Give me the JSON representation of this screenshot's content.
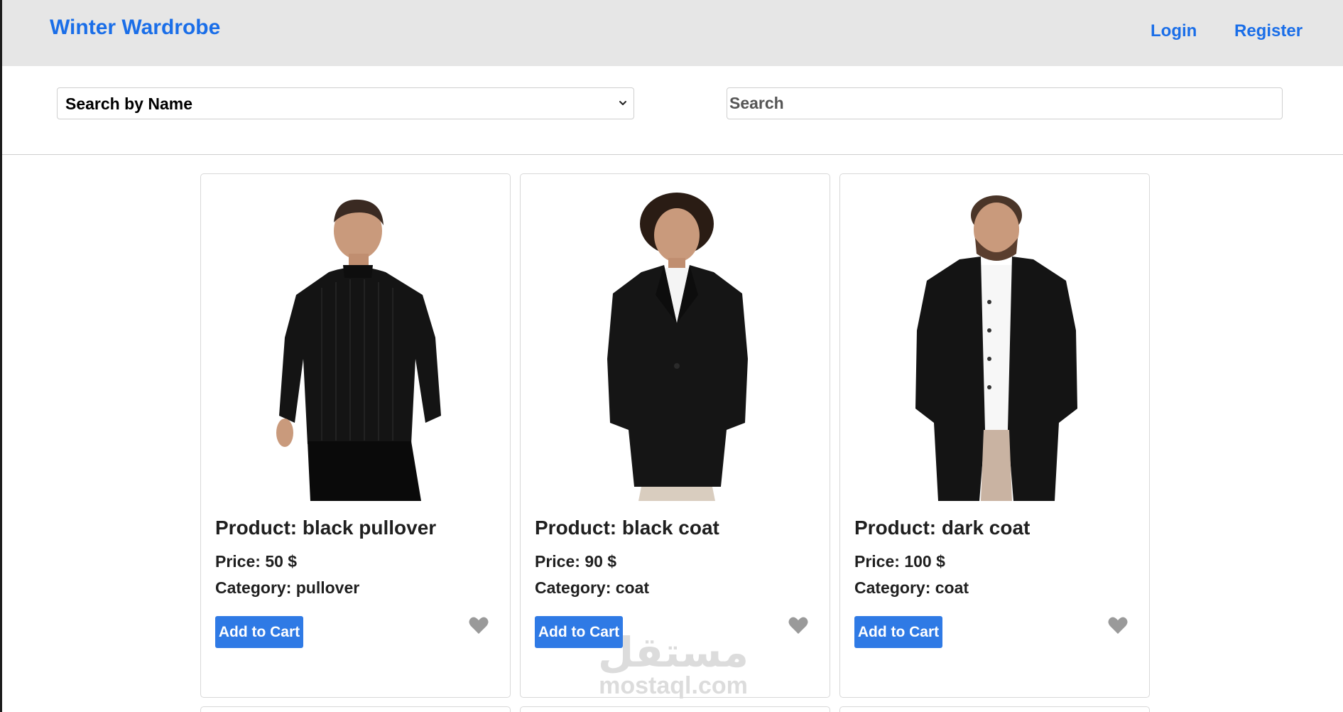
{
  "navbar": {
    "brand": "Winter Wardrobe",
    "login_label": "Login",
    "register_label": "Register"
  },
  "search": {
    "select_value": "Search by Name",
    "input_placeholder": "Search",
    "input_value": ""
  },
  "products": [
    {
      "title": "Product: black pullover",
      "price": "Price: 50 $",
      "category": "Category: pullover",
      "add_label": "Add to Cart",
      "image_icon": "man-black-pullover-photo",
      "favorite_icon": "heart-icon"
    },
    {
      "title": "Product: black coat",
      "price": "Price: 90 $",
      "category": "Category: coat",
      "add_label": "Add to Cart",
      "image_icon": "man-black-coat-photo",
      "favorite_icon": "heart-icon"
    },
    {
      "title": "Product: dark coat",
      "price": "Price: 100 $",
      "category": "Category: coat",
      "add_label": "Add to Cart",
      "image_icon": "man-dark-coat-photo",
      "favorite_icon": "heart-icon"
    }
  ],
  "watermark": {
    "arabic": "مستقل",
    "latin": "mostaql.com"
  },
  "colors": {
    "brand_blue": "#1a6ee8",
    "button_blue": "#2f7ae5",
    "navbar_bg": "#e6e6e6",
    "heart_gray": "#9a9a9a"
  }
}
